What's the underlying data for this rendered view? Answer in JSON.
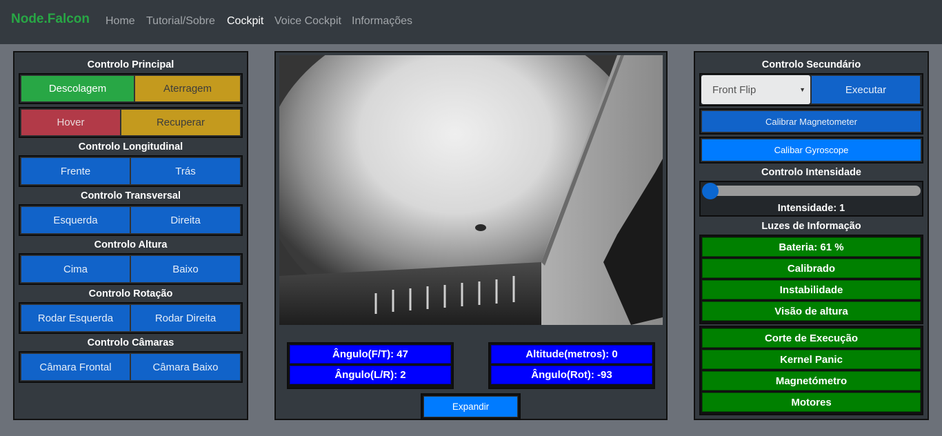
{
  "nav": {
    "brand": "Node.Falcon",
    "links": [
      "Home",
      "Tutorial/Sobre",
      "Cockpit",
      "Voice Cockpit",
      "Informações"
    ]
  },
  "left": {
    "principal": {
      "title": "Controlo Principal",
      "takeoff": "Descolagem",
      "land": "Aterragem",
      "hover": "Hover",
      "recover": "Recuperar"
    },
    "longitudinal": {
      "title": "Controlo Longitudinal",
      "front": "Frente",
      "back": "Trás"
    },
    "transversal": {
      "title": "Controlo Transversal",
      "left": "Esquerda",
      "right": "Direita"
    },
    "altura": {
      "title": "Controlo Altura",
      "up": "Cima",
      "down": "Baixo"
    },
    "rotacao": {
      "title": "Controlo Rotação",
      "left": "Rodar Esquerda",
      "right": "Rodar Direita"
    },
    "camaras": {
      "title": "Controlo Câmaras",
      "front": "Câmara Frontal",
      "bottom": "Câmara Baixo"
    }
  },
  "center": {
    "angle_ft": "Ângulo(F/T): 47",
    "angle_lr": "Ângulo(L/R): 2",
    "altitude": "Altitude(metros): 0",
    "angle_rot": "Ângulo(Rot): -93",
    "expand": "Expandir"
  },
  "right": {
    "secundario_title": "Controlo Secundário",
    "select_value": "Front Flip",
    "execute": "Executar",
    "calib_mag": "Calibrar Magnetometer",
    "calib_gyro": "Calibar Gyroscope",
    "intensidade_title": "Controlo Intensidade",
    "intensity_level": 1,
    "intensidade_label": "Intensidade: 1",
    "luzes_title": "Luzes de Informação",
    "lights_a": [
      "Bateria: 61 %",
      "Calibrado",
      "Instabilidade",
      "Visão de altura"
    ],
    "lights_b": [
      "Corte de Execução",
      "Kernel Panic",
      "Magnetómetro",
      "Motores"
    ]
  },
  "colors": {
    "navbar": "#343a40",
    "brand": "#28a745",
    "control_blue": "#1163c9",
    "info_blue": "#0000ff",
    "light_green": "#008000"
  }
}
